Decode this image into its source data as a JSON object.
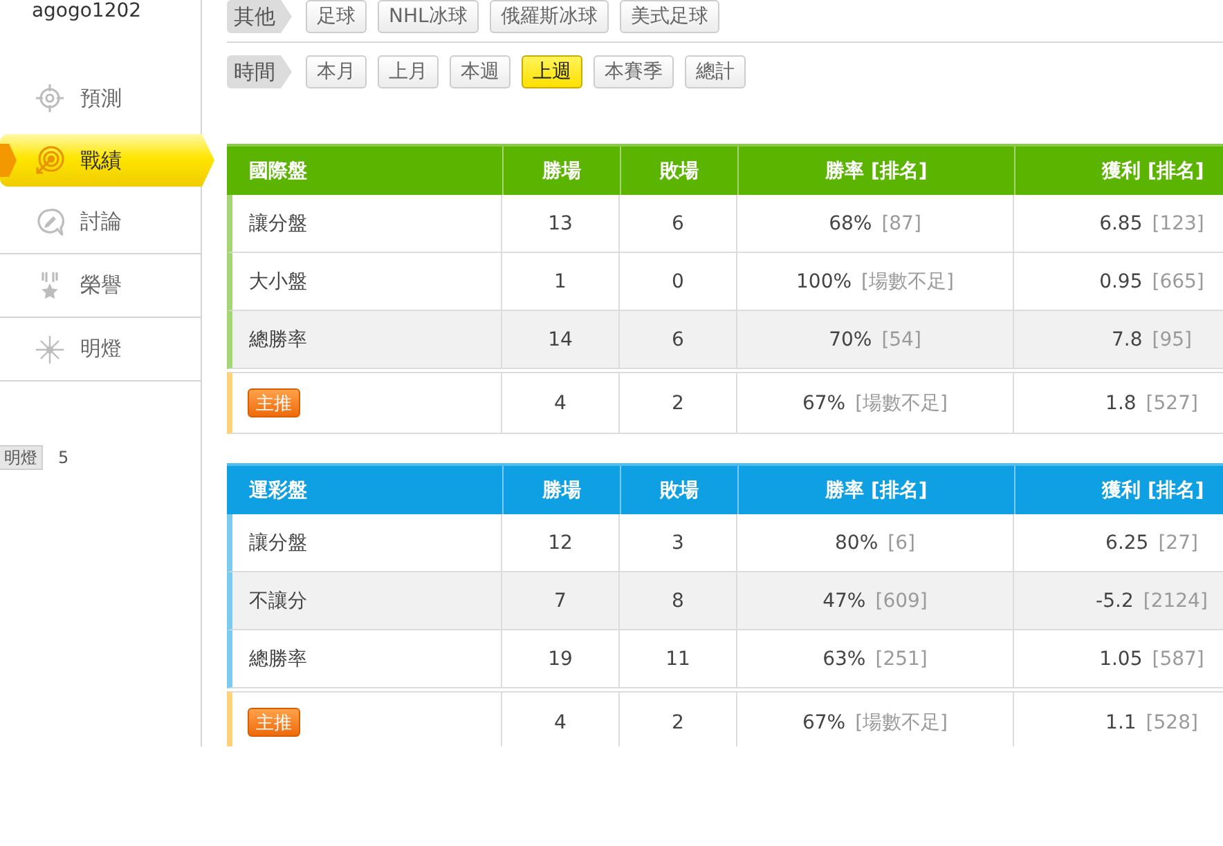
{
  "sidebar": {
    "username": "agogo1202",
    "items": [
      {
        "label": "預測",
        "selected": false
      },
      {
        "label": "戰績",
        "selected": true
      },
      {
        "label": "討論",
        "selected": false
      },
      {
        "label": "榮譽",
        "selected": false
      },
      {
        "label": "明燈",
        "selected": false
      }
    ],
    "stats": [
      {
        "label": "明燈",
        "value": "5"
      }
    ]
  },
  "filters": [
    {
      "label": "其他",
      "options": [
        {
          "label": "足球",
          "selected": false
        },
        {
          "label": "NHL冰球",
          "selected": false
        },
        {
          "label": "俄羅斯冰球",
          "selected": false
        },
        {
          "label": "美式足球",
          "selected": false
        }
      ]
    },
    {
      "label": "時間",
      "options": [
        {
          "label": "本月",
          "selected": false
        },
        {
          "label": "上月",
          "selected": false
        },
        {
          "label": "本週",
          "selected": false
        },
        {
          "label": "上週",
          "selected": true
        },
        {
          "label": "本賽季",
          "selected": false
        },
        {
          "label": "總計",
          "selected": false
        }
      ]
    }
  ],
  "tables": [
    {
      "color": "#5ab400",
      "columns": [
        "國際盤",
        "勝場",
        "敗場",
        "勝率 [排名]",
        "獲利 [排名]"
      ],
      "rows": [
        {
          "name": "讓分盤",
          "wins": "13",
          "losses": "6",
          "rate": "68%",
          "rate_rank": "[87]",
          "profit": "6.85",
          "profit_rank": "[123]",
          "highlighted": false
        },
        {
          "name": "大小盤",
          "wins": "1",
          "losses": "0",
          "rate": "100%",
          "rate_rank": "[場數不足]",
          "profit": "0.95",
          "profit_rank": "[665]",
          "highlighted": false
        },
        {
          "name": "總勝率",
          "wins": "14",
          "losses": "6",
          "rate": "70%",
          "rate_rank": "[54]",
          "profit": "7.8",
          "profit_rank": "[95]",
          "highlighted": true
        }
      ],
      "featured": {
        "badge": "主推",
        "wins": "4",
        "losses": "2",
        "rate": "67%",
        "rate_rank": "[場數不足]",
        "profit": "1.8",
        "profit_rank": "[527]"
      }
    },
    {
      "color": "#0ea0e2",
      "columns": [
        "運彩盤",
        "勝場",
        "敗場",
        "勝率 [排名]",
        "獲利 [排名]"
      ],
      "rows": [
        {
          "name": "讓分盤",
          "wins": "12",
          "losses": "3",
          "rate": "80%",
          "rate_rank": "[6]",
          "profit": "6.25",
          "profit_rank": "[27]",
          "highlighted": false
        },
        {
          "name": "不讓分",
          "wins": "7",
          "losses": "8",
          "rate": "47%",
          "rate_rank": "[609]",
          "profit": "-5.2",
          "profit_rank": "[2124]",
          "highlighted": true
        },
        {
          "name": "總勝率",
          "wins": "19",
          "losses": "11",
          "rate": "63%",
          "rate_rank": "[251]",
          "profit": "1.05",
          "profit_rank": "[587]",
          "highlighted": false
        }
      ],
      "featured": {
        "badge": "主推",
        "wins": "4",
        "losses": "2",
        "rate": "67%",
        "rate_rank": "[場數不足]",
        "profit": "1.1",
        "profit_rank": "[528]"
      }
    }
  ]
}
